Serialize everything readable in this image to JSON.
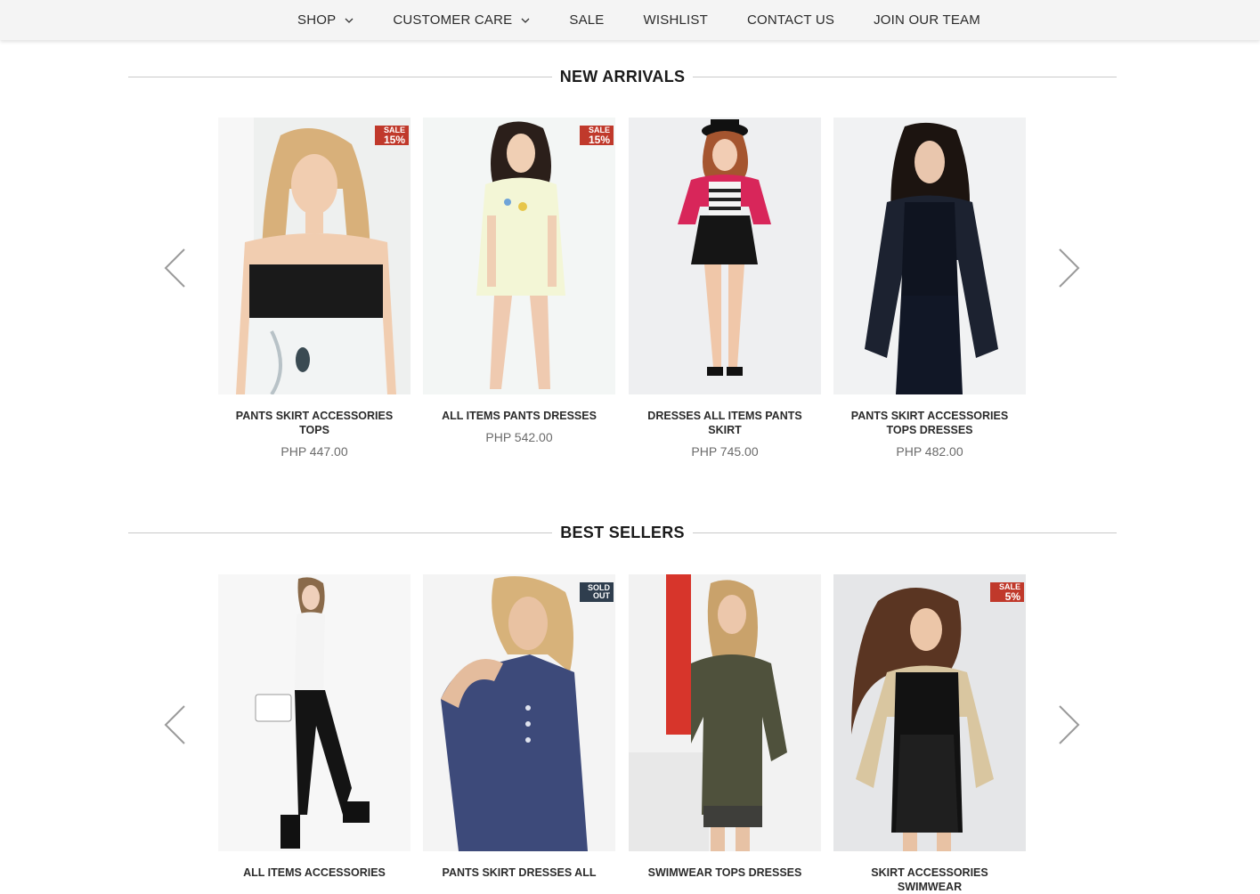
{
  "nav": {
    "items": [
      {
        "label": "SHOP",
        "dropdown": true
      },
      {
        "label": "CUSTOMER CARE",
        "dropdown": true
      },
      {
        "label": "SALE",
        "dropdown": false
      },
      {
        "label": "WISHLIST",
        "dropdown": false
      },
      {
        "label": "CONTACT US",
        "dropdown": false
      },
      {
        "label": "JOIN OUR TEAM",
        "dropdown": false
      }
    ]
  },
  "sections": {
    "new_arrivals": {
      "title": "NEW ARRIVALS",
      "products": [
        {
          "name": "PANTS SKIRT ACCESSORIES TOPS",
          "price": "PHP 447.00",
          "badge_top": "SALE",
          "badge_bottom": "15%"
        },
        {
          "name": "ALL ITEMS PANTS DRESSES",
          "price": "PHP 542.00",
          "badge_top": "SALE",
          "badge_bottom": "15%"
        },
        {
          "name": "DRESSES ALL ITEMS PANTS SKIRT",
          "price": "PHP 745.00"
        },
        {
          "name": "PANTS SKIRT ACCESSORIES TOPS DRESSES",
          "price": "PHP 482.00"
        }
      ]
    },
    "best_sellers": {
      "title": "BEST SELLERS",
      "products": [
        {
          "name": "ALL ITEMS ACCESSORIES"
        },
        {
          "name": "PANTS SKIRT DRESSES ALL",
          "badge_top": "SOLD",
          "badge_bottom": "OUT"
        },
        {
          "name": "SWIMWEAR TOPS DRESSES"
        },
        {
          "name": "SKIRT ACCESSORIES SWIMWEAR",
          "badge_top": "SALE",
          "badge_bottom": "5%"
        }
      ]
    }
  },
  "colors": {
    "sale_badge": "#c0392b",
    "soldout_badge": "#2f3e4e",
    "nav_bg": "#f4f4f4",
    "divider": "#c9c9c9"
  },
  "icons": {
    "nav_caret": "chevron-down-icon",
    "carousel_prev": "chevron-left-icon",
    "carousel_next": "chevron-right-icon"
  }
}
